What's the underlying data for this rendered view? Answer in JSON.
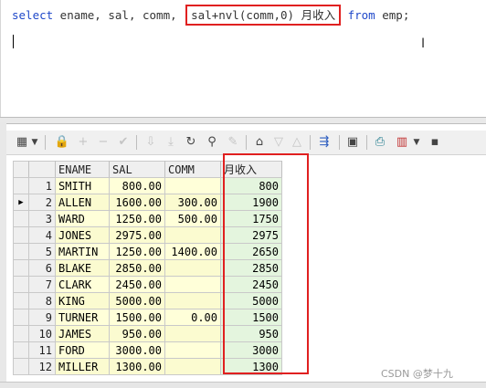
{
  "editor": {
    "sql_prefix_kw": "select",
    "sql_cols": " ename, sal, comm, ",
    "sql_highlight": "sal+nvl(comm,0) 月收入",
    "sql_from_kw": "from",
    "sql_suffix": " emp;"
  },
  "grid": {
    "headers": [
      "ENAME",
      "SAL",
      "COMM",
      "月收入"
    ],
    "current_row_marker": "▶",
    "rows": [
      {
        "n": "1",
        "ename": "SMITH",
        "sal": "800.00",
        "comm": "",
        "inc": "800"
      },
      {
        "n": "2",
        "ename": "ALLEN",
        "sal": "1600.00",
        "comm": "300.00",
        "inc": "1900"
      },
      {
        "n": "3",
        "ename": "WARD",
        "sal": "1250.00",
        "comm": "500.00",
        "inc": "1750"
      },
      {
        "n": "4",
        "ename": "JONES",
        "sal": "2975.00",
        "comm": "",
        "inc": "2975"
      },
      {
        "n": "5",
        "ename": "MARTIN",
        "sal": "1250.00",
        "comm": "1400.00",
        "inc": "2650"
      },
      {
        "n": "6",
        "ename": "BLAKE",
        "sal": "2850.00",
        "comm": "",
        "inc": "2850"
      },
      {
        "n": "7",
        "ename": "CLARK",
        "sal": "2450.00",
        "comm": "",
        "inc": "2450"
      },
      {
        "n": "8",
        "ename": "KING",
        "sal": "5000.00",
        "comm": "",
        "inc": "5000"
      },
      {
        "n": "9",
        "ename": "TURNER",
        "sal": "1500.00",
        "comm": "0.00",
        "inc": "1500"
      },
      {
        "n": "10",
        "ename": "JAMES",
        "sal": "950.00",
        "comm": "",
        "inc": "950"
      },
      {
        "n": "11",
        "ename": "FORD",
        "sal": "3000.00",
        "comm": "",
        "inc": "3000"
      },
      {
        "n": "12",
        "ename": "MILLER",
        "sal": "1300.00",
        "comm": "",
        "inc": "1300"
      }
    ]
  },
  "toolbar": {
    "icons": [
      "grid-view-icon",
      "dropdown-arrow-icon",
      "lock-icon",
      "add-record-icon",
      "delete-record-icon",
      "post-changes-icon",
      "next-record-icon",
      "last-record-icon",
      "refresh-icon",
      "find-icon",
      "clear-icon",
      "query-by-example-icon",
      "filter-icon",
      "sort-icon",
      "export-icon",
      "save-icon",
      "print-icon",
      "chart-icon"
    ]
  },
  "watermark": "CSDN @梦十九"
}
